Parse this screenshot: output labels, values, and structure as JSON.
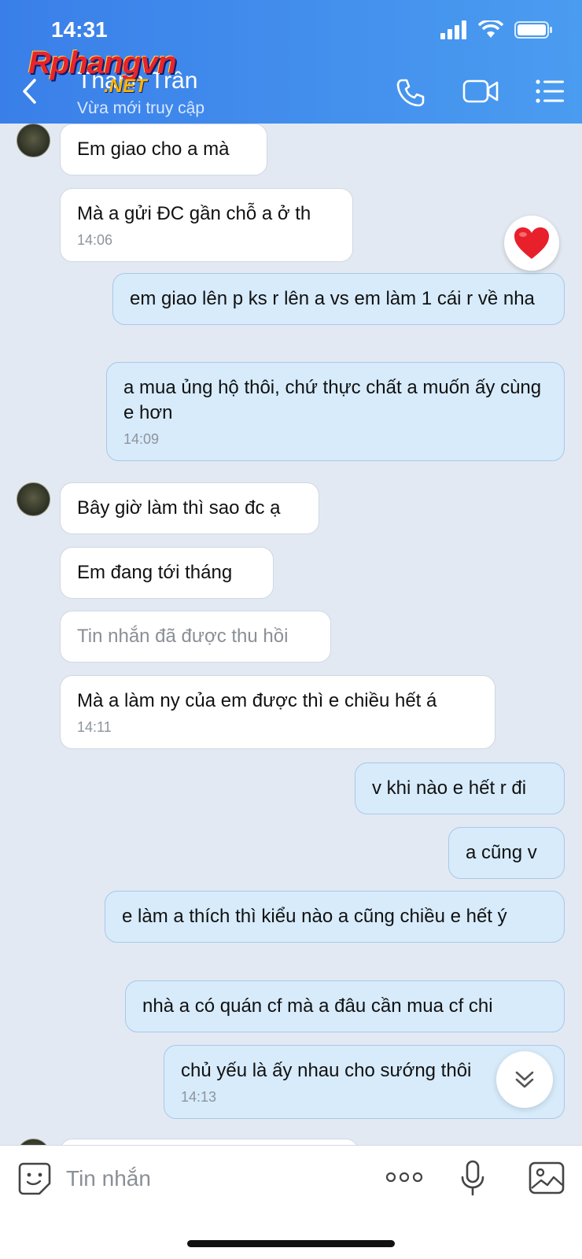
{
  "status_bar": {
    "time": "14:31"
  },
  "header": {
    "contact_name": "Thanh Trần",
    "contact_status": "Vừa mới truy cập",
    "watermark": "Rphangvn",
    "watermark_sub": ".NET"
  },
  "messages": [
    {
      "text": "Em giao cho a mà"
    },
    {
      "text": "Mà a gửi ĐC gần chỗ a ở th",
      "time": "14:06"
    },
    {
      "text": "em giao lên p ks r lên a vs em làm 1 cái r về nha"
    },
    {
      "text": "a mua ủng hộ thôi, chứ thực chất a muốn ấy cùng e hơn",
      "time": "14:09"
    },
    {
      "text": "Bây giờ làm thì sao đc ạ"
    },
    {
      "text": "Em đang tới tháng"
    },
    {
      "text": "Tin nhắn đã được thu hồi"
    },
    {
      "text": "Mà a làm ny của em được thì e chiều hết á",
      "time": "14:11"
    },
    {
      "text": "v khi nào e hết r đi"
    },
    {
      "text": "a cũng v"
    },
    {
      "text": "e làm a thích thì kiểu nào a cũng chiều e hết ý"
    },
    {
      "text": "nhà a có  quán cf mà a đâu cần mua cf chi"
    },
    {
      "text": "chủ yếu là ấy nhau cho sướng thôi",
      "time": "14:13"
    }
  ],
  "composer": {
    "placeholder": "Tin nhắn"
  },
  "colors": {
    "header": "#3a7fe9",
    "incoming": "#ffffff",
    "outgoing": "#d7ebfb",
    "background": "#e2e9f2"
  }
}
